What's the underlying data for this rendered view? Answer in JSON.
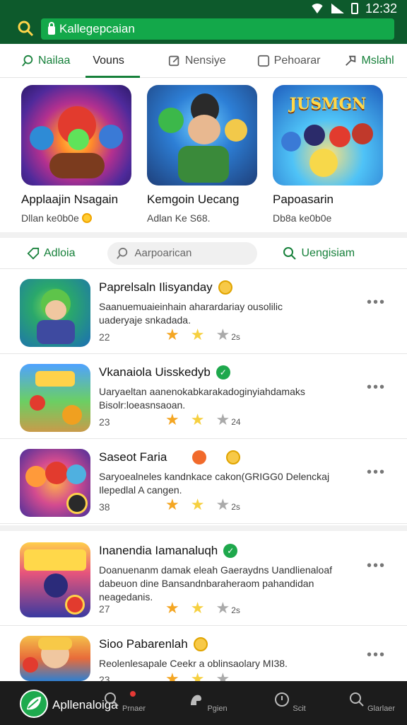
{
  "status": {
    "time": "12:32"
  },
  "top": {
    "url_text": "Kallegepcaian"
  },
  "tabs": [
    {
      "label": "Nailaa",
      "icon": "search-icon"
    },
    {
      "label": "Vouns",
      "icon": ""
    },
    {
      "label": "Nensiye",
      "icon": "edit-icon"
    },
    {
      "label": "Pehoarar",
      "icon": "square-icon"
    },
    {
      "label": "Mslahl",
      "icon": "share-icon"
    }
  ],
  "featured": [
    {
      "title": "Applaajin Nsagain",
      "sub": "Dllan ke0b0e"
    },
    {
      "title": "Kemgoin Uecang",
      "sub": "Adlan Ke S68."
    },
    {
      "title": "Papoasarin",
      "sub": "Db8a ke0b0e"
    }
  ],
  "featured_art_label": "JUSMGN",
  "filter": {
    "left": "Adloia",
    "search_placeholder": "Aarpoarican",
    "right": "Uengisiam"
  },
  "items": [
    {
      "title": "Paprelsaln Ilisyanday",
      "desc": "Saanuemuaieinhain aharardariay ousolilic uaderyaje snkadada.",
      "count": "22",
      "rating": "2s",
      "badge": "gold"
    },
    {
      "title": "Vkanaiola Uisskedyb",
      "desc": "Uaryaeltan aanenokabkarakadoginyiahdamaks Bisolr:loeasnsaoan.",
      "count": "23",
      "rating": "24",
      "badge": "green"
    },
    {
      "title": "Saseot Faria",
      "desc": "Saryoealneles kandnkace cakon(GRIGG0 Delenckaj Ilepedlal A cangen.",
      "count": "38",
      "rating": "2s",
      "badge": "orange-gold"
    },
    {
      "title": "Inanendia Iamanaluqh",
      "desc": "Doanuenanm damak eleah Gaeraydns Uandlienaloaf dabeuon dine Bansandnbaraheraom pahandidan neagedanis.",
      "count": "27",
      "rating": "2s",
      "badge": "green"
    },
    {
      "title": "Sioo Pabarenlah",
      "desc": "Reolenlesapale Ceekr a oblinsaolary MI38.",
      "count": "23",
      "rating": "",
      "badge": "gold"
    }
  ],
  "bottom_nav": {
    "app_name": "Apllenaloiga",
    "items": [
      "Prnaer",
      "Pgien",
      "Scit",
      "Glarlaer"
    ]
  }
}
